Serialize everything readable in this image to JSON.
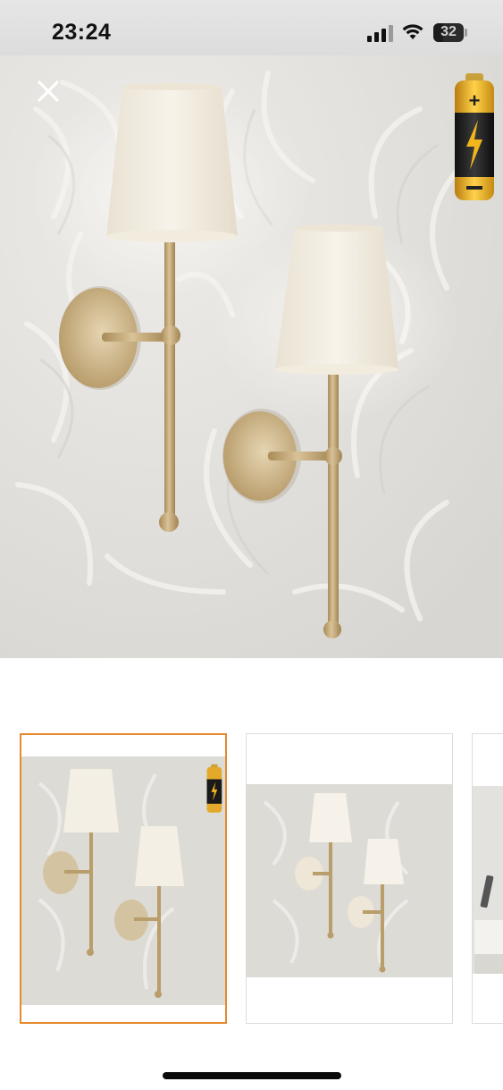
{
  "status_bar": {
    "time": "23:24",
    "battery_percent": "32",
    "battery_level": 0.32,
    "icons": [
      "cellular-signal-icon",
      "wifi-icon",
      "battery-icon"
    ]
  },
  "viewer": {
    "close_icon": "close-icon",
    "overlay_badge_icon": "battery-charging-icon",
    "selected_thumbnail": 1
  },
  "thumbnails": [
    {
      "id": "thumbnail-1",
      "selected": true
    },
    {
      "id": "thumbnail-2",
      "selected": false
    },
    {
      "id": "thumbnail-3",
      "selected": false
    }
  ],
  "colors": {
    "selected_border": "#e58a2e",
    "brass": "#c5a874",
    "shade": "#f1ebdf",
    "wall": "#e2e0dc"
  }
}
